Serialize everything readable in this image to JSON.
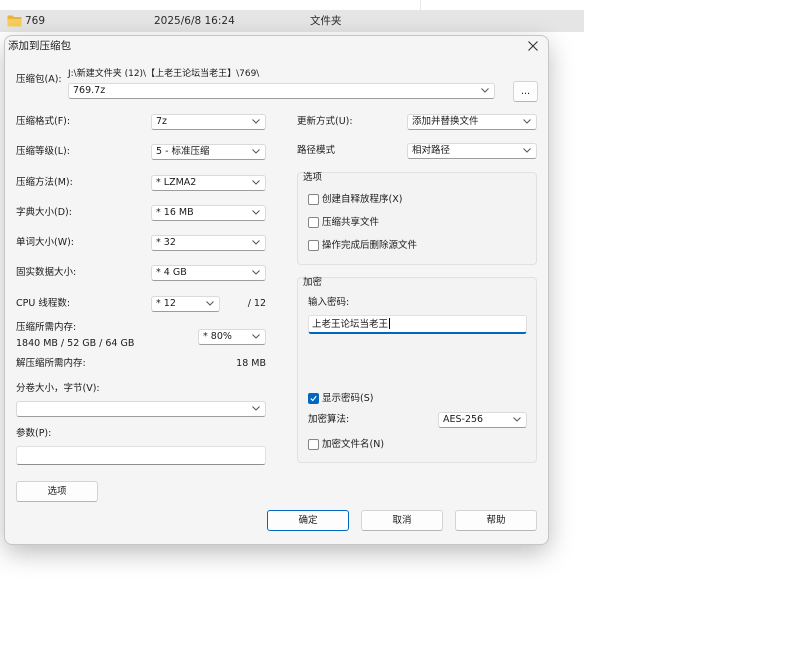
{
  "file_row": {
    "icon": "folder-icon",
    "name": "769",
    "modified": "2025/6/8 16:24",
    "type": "文件夹"
  },
  "dialog": {
    "title": "添加到压缩包",
    "close_icon": "close-icon",
    "archive": {
      "label": "压缩包(A):",
      "path": "J:\\新建文件夹 (12)\\【上老王论坛当老王】\\769\\",
      "value": "769.7z",
      "browse": "..."
    },
    "format": {
      "label": "压缩格式(F):",
      "value": "7z"
    },
    "level": {
      "label": "压缩等级(L):",
      "value": "5 - 标准压缩"
    },
    "method": {
      "label": "压缩方法(M):",
      "value": "* LZMA2"
    },
    "dictionary": {
      "label": "字典大小(D):",
      "value": "* 16 MB"
    },
    "word_size": {
      "label": "单词大小(W):",
      "value": "* 32"
    },
    "solid_block": {
      "label": "固实数据大小:",
      "value": "* 4 GB"
    },
    "threads": {
      "label": "CPU 线程数:",
      "value": "* 12",
      "max": "/ 12"
    },
    "memory_compress": {
      "label": "压缩所需内存:",
      "detail": "1840 MB / 52 GB / 64 GB",
      "value": "* 80%"
    },
    "memory_decompress": {
      "label": "解压缩所需内存:",
      "value": "18 MB"
    },
    "split": {
      "label": "分卷大小，字节(V):"
    },
    "parameters": {
      "label": "参数(P):"
    },
    "options_button": "选项",
    "update_mode": {
      "label": "更新方式(U):",
      "value": "添加并替换文件"
    },
    "path_mode": {
      "label": "路径模式",
      "value": "相对路径"
    },
    "options_group": {
      "title": "选项",
      "items": [
        {
          "label": "创建自释放程序(X)",
          "checked": false
        },
        {
          "label": "压缩共享文件",
          "checked": false
        },
        {
          "label": "操作完成后删除源文件",
          "checked": false
        }
      ]
    },
    "encryption": {
      "title": "加密",
      "password_label": "输入密码:",
      "password": "上老王论坛当老王",
      "show_password": {
        "label": "显示密码(S)",
        "checked": true
      },
      "method_label": "加密算法:",
      "method": "AES-256",
      "encrypt_names": {
        "label": "加密文件名(N)",
        "checked": false
      }
    },
    "buttons": {
      "ok": "确定",
      "cancel": "取消",
      "help": "帮助"
    }
  },
  "icons": {
    "dropdown": "chevron-down-icon",
    "check": "checkmark-icon"
  },
  "colors": {
    "accent": "#0067c0",
    "row_selected": "#e5e5e5",
    "folder": "#f4c542"
  }
}
